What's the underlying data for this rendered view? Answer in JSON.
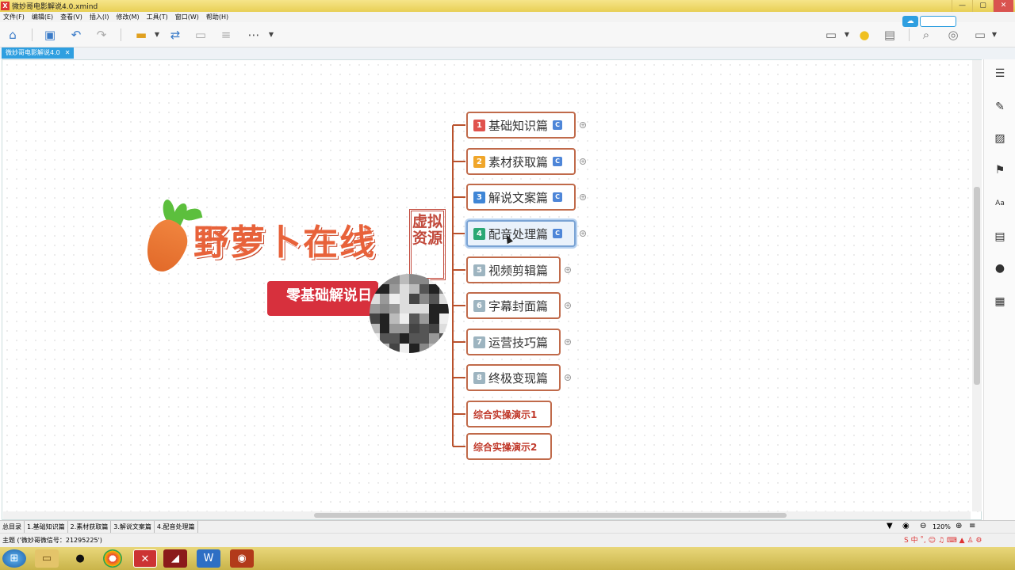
{
  "window": {
    "title": "微妙哥电影解说4.0.xmind"
  },
  "menu": [
    "文件(F)",
    "编辑(E)",
    "查看(V)",
    "插入(I)",
    "修改(M)",
    "工具(T)",
    "窗口(W)",
    "帮助(H)"
  ],
  "tab": {
    "label": "微妙哥电影解说4.0",
    "close": "✕"
  },
  "logo": {
    "title": "野萝卜在线",
    "seal": "虚拟资源",
    "banner": "零基础解说",
    "banner_partial": "日"
  },
  "branches": [
    {
      "num": "1",
      "label": "基础知识篇",
      "color": "#e0524d",
      "has_c": true,
      "c": "C"
    },
    {
      "num": "2",
      "label": "素材获取篇",
      "color": "#f0a62a",
      "has_c": true,
      "c": "C"
    },
    {
      "num": "3",
      "label": "解说文案篇",
      "color": "#3f86d6",
      "has_c": true,
      "c": "C"
    },
    {
      "num": "4",
      "label": "配音处理篇",
      "color": "#2aa874",
      "has_c": true,
      "c": "C"
    },
    {
      "num": "5",
      "label": "视频剪辑篇",
      "color": "#9db4c0",
      "has_c": false
    },
    {
      "num": "6",
      "label": "字幕封面篇",
      "color": "#9db4c0",
      "has_c": false
    },
    {
      "num": "7",
      "label": "运营技巧篇",
      "color": "#9db4c0",
      "has_c": false
    },
    {
      "num": "8",
      "label": "终极变现篇",
      "color": "#9db4c0",
      "has_c": false
    }
  ],
  "extra_nodes": [
    "综合实操演示1",
    "综合实操演示2"
  ],
  "sheets": [
    "总目录",
    "1.基础知识篇",
    "2.素材获取篇",
    "3.解说文案篇",
    "4.配音处理篇"
  ],
  "zoom": "120%",
  "status": "主题 ('微妙哥微信号：21295225')",
  "colors": {
    "accent": "#2f9fe0",
    "branch": "#b9512c",
    "banner": "#d7303d"
  }
}
